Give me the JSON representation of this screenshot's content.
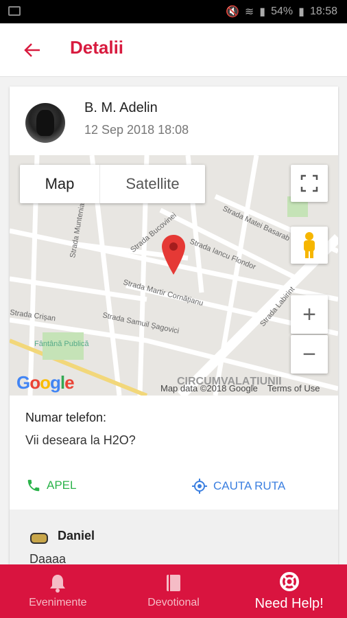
{
  "status": {
    "battery": "54%",
    "time": "18:58"
  },
  "appbar": {
    "title": "Detalii"
  },
  "post": {
    "author": "B. M. Adelin",
    "date": "12 Sep 2018 18:08"
  },
  "map": {
    "map_label": "Map",
    "satellite_label": "Satellite",
    "google": "Google",
    "map_data": "Map data ©2018 Google",
    "terms": "Terms of Use",
    "streets": [
      "Strada Muntenia",
      "Strada Bucovinei",
      "Strada Iancu Flondor",
      "Strada Matei Basarab",
      "Strada Martir Cornățianu",
      "Strada Samuil Șagovici",
      "Strada Crișan",
      "Strada Labirint",
      "Fântână Publică",
      "CIRCUMVALAȚIUNII",
      "Strada Bucovinei"
    ]
  },
  "details": {
    "phone_label": "Numar telefon:",
    "message": "Vii deseara la H2O?",
    "call_label": "APEL",
    "route_label": "CAUTA RUTA"
  },
  "comment": {
    "author": "Daniel",
    "text": "Daaaa"
  },
  "nav": {
    "events": "Evenimente",
    "devotional": "Devotional",
    "help": "Need Help!"
  },
  "colors": {
    "accent": "#d81b3f",
    "call": "#2bb34a",
    "route": "#3b7fe0",
    "nav_bg": "#d9143f"
  }
}
